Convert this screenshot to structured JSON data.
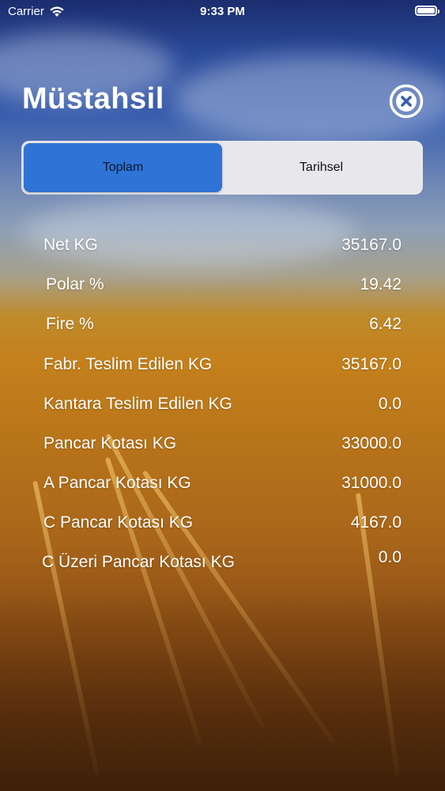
{
  "status_bar": {
    "carrier": "Carrier",
    "time": "9:33 PM"
  },
  "header": {
    "title": "Müstahsil",
    "close_icon": "close-circle-icon"
  },
  "segments": {
    "items": [
      {
        "label": "Toplam",
        "selected": true
      },
      {
        "label": "Tarihsel",
        "selected": false
      }
    ],
    "active_color": "#2f73d6",
    "background_color": "#e8e8ec"
  },
  "rows": [
    {
      "label": "Net KG",
      "value": "35167.0"
    },
    {
      "label": "Polar %",
      "value": "19.42"
    },
    {
      "label": "Fire %",
      "value": "6.42"
    },
    {
      "label": "Fabr. Teslim Edilen KG",
      "value": "35167.0"
    },
    {
      "label": "Kantara Teslim Edilen KG",
      "value": "0.0"
    },
    {
      "label": "Pancar Kotası KG",
      "value": "33000.0"
    },
    {
      "label": "A Pancar Kotası KG",
      "value": "31000.0"
    },
    {
      "label": "C Pancar Kotası KG",
      "value": "4167.0"
    },
    {
      "label": "C Üzeri Pancar Kotası KG",
      "value": "0.0"
    }
  ]
}
